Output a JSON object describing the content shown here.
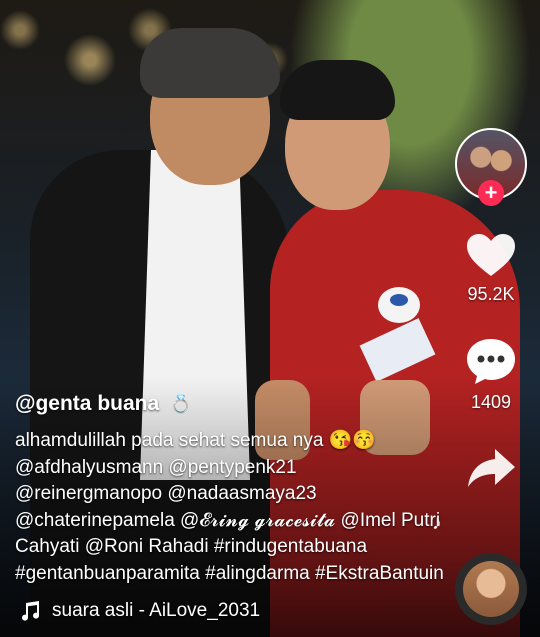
{
  "video": {
    "username": "@genta buana",
    "username_badge_icon": "ring-icon",
    "caption": "alhamdulillah pada sehat semua nya 😘😚 @afdhalyusmann @pentypenk21 @reinergmanopo @nadaasmaya23 @chaterinepamela @𝓔𝓻𝓲𝓷𝓰 𝓰𝓻𝓪𝓬𝓮𝓼𝓲𝓽𝓪 @Imel Putri Cahyati @Roni Rahadi #rindugentabuana #gentanbuanparamita #alingdarma #EkstraBantuin"
  },
  "actions": {
    "follow_label": "+",
    "like_count": "95.2K",
    "comment_count": "1409"
  },
  "music": {
    "label": "suara asli - AiLove_2031"
  },
  "colors": {
    "follow_accent": "#fe2c55",
    "text": "#ffffff"
  }
}
